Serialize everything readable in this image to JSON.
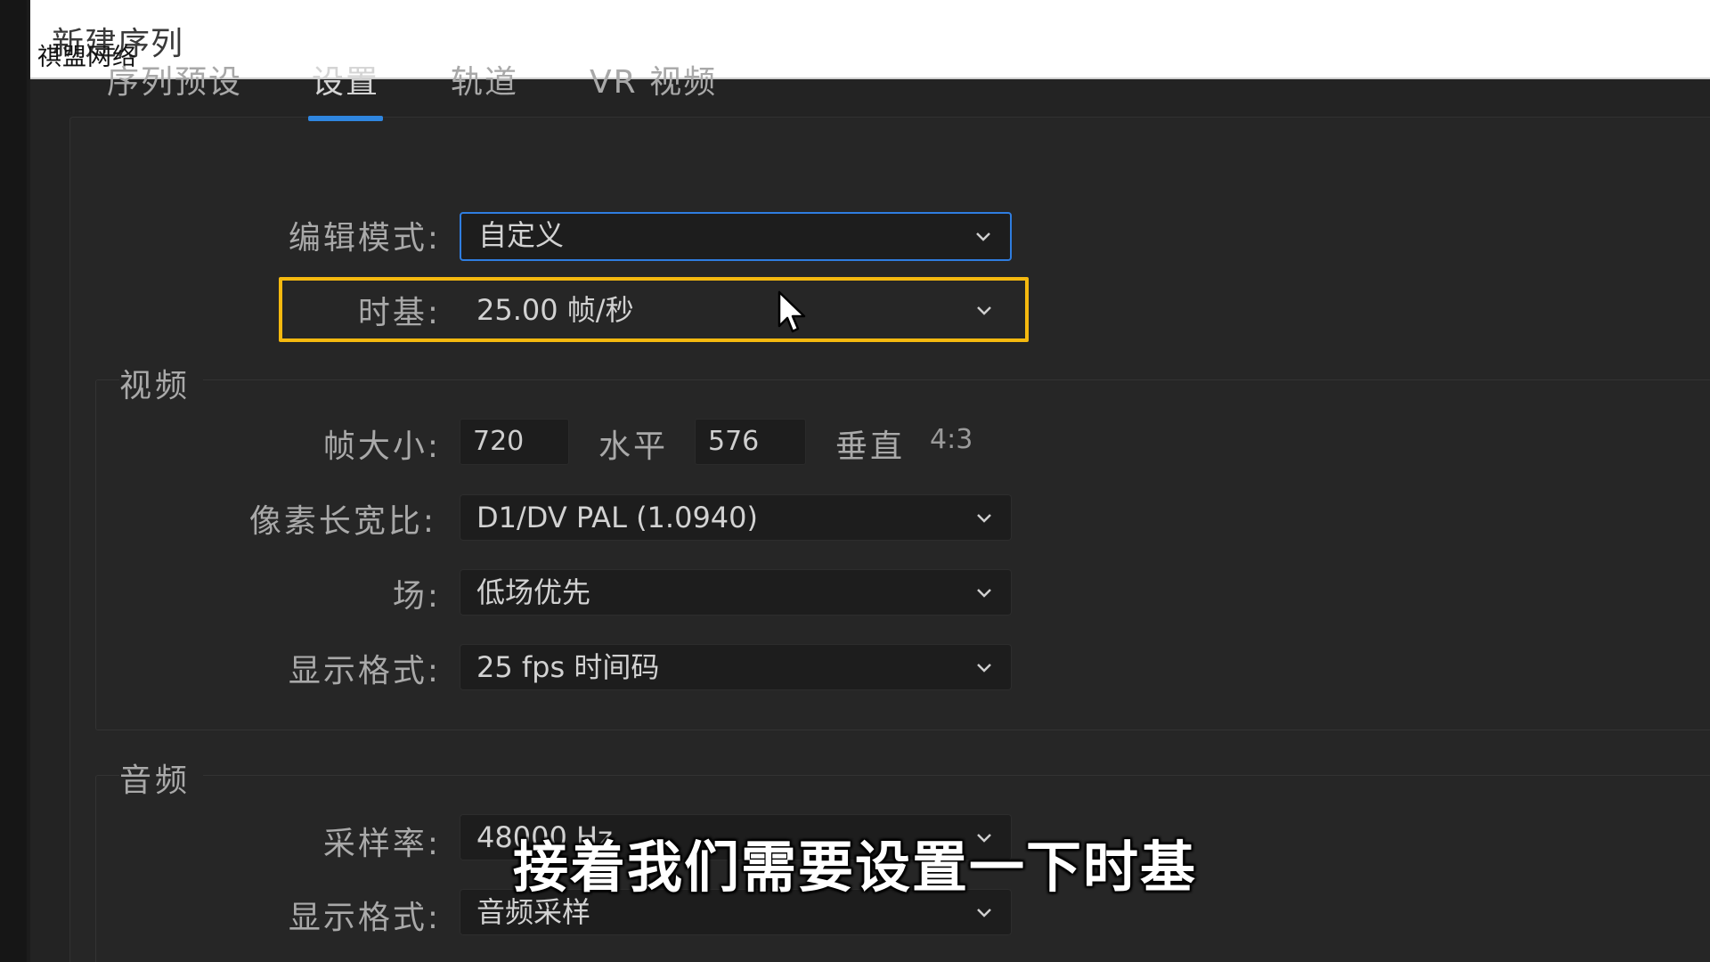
{
  "window": {
    "title": "新建序列"
  },
  "watermark": "祺盟网络",
  "tabs": [
    {
      "label": "序列预设",
      "active": false
    },
    {
      "label": "设置",
      "active": true
    },
    {
      "label": "轨道",
      "active": false
    },
    {
      "label": "VR 视频",
      "active": false
    }
  ],
  "settings": {
    "edit_mode": {
      "label": "编辑模式:",
      "value": "自定义"
    },
    "timebase": {
      "label": "时基:",
      "value": "25.00 帧/秒"
    }
  },
  "video": {
    "section_title": "视频",
    "frame_size": {
      "label": "帧大小:",
      "width": "720",
      "horizontal_label": "水平",
      "height": "576",
      "vertical_label": "垂直",
      "ratio": "4:3"
    },
    "pixel_aspect": {
      "label": "像素长宽比:",
      "value": "D1/DV PAL (1.0940)"
    },
    "fields": {
      "label": "场:",
      "value": "低场优先"
    },
    "display_format": {
      "label": "显示格式:",
      "value": "25 fps 时间码"
    }
  },
  "audio": {
    "section_title": "音频",
    "sample_rate": {
      "label": "采样率:",
      "value": "48000 Hz"
    },
    "display_format": {
      "label": "显示格式:",
      "value": "音频采样"
    }
  },
  "subtitle": "接着我们需要设置一下时基",
  "colors": {
    "highlight": "#f5b90f",
    "focus": "#2f7de0",
    "tab_underline": "#2f86e0"
  }
}
